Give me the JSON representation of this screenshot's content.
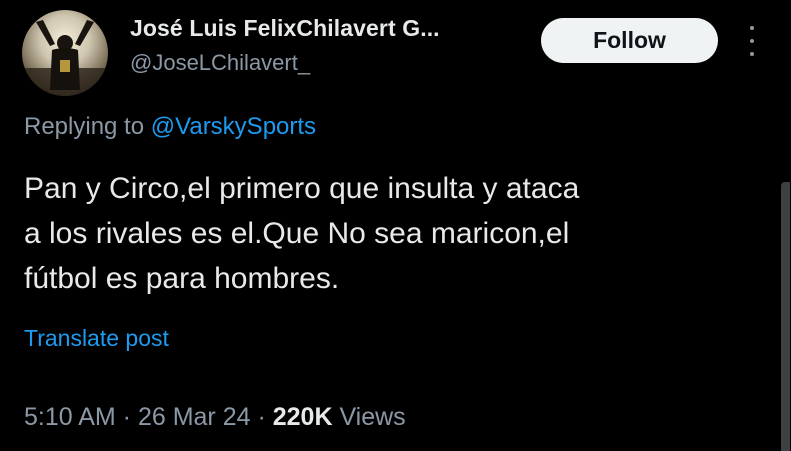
{
  "author": {
    "display_name": "José Luis FelixChilavert G...",
    "handle": "@JoseLChilavert_",
    "avatar_icon": "profile-photo"
  },
  "header": {
    "follow_label": "Follow",
    "more_icon": "more-vertical-icon"
  },
  "reply": {
    "prefix": "Replying to ",
    "mention": "@VarskySports"
  },
  "tweet": {
    "lines": [
      "Pan y Circo,el primero que insulta y ataca",
      "a los rivales es el.Que No sea maricon,el",
      "fútbol es para hombres."
    ]
  },
  "translate_label": "Translate post",
  "meta": {
    "time": "5:10 AM",
    "separator": " · ",
    "date": "26 Mar 24",
    "views_count": "220K",
    "views_label": " Views"
  },
  "colors": {
    "background": "#000000",
    "text": "#e7e9ea",
    "secondary": "#8b98a5",
    "accent": "#1d9bf0",
    "button_bg": "#eff3f4"
  }
}
